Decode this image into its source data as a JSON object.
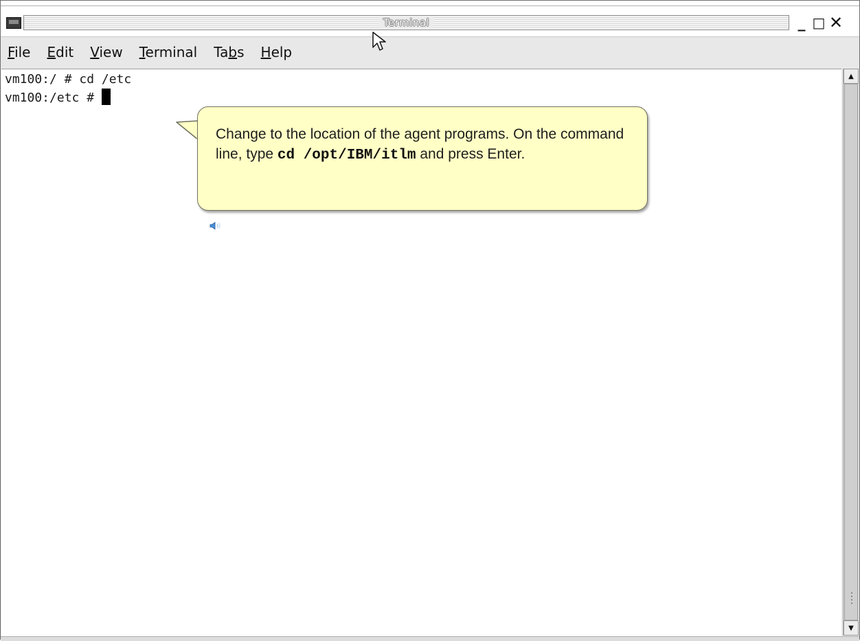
{
  "window": {
    "title": "Terminal",
    "controls": {
      "minimize": "_",
      "maximize": "□",
      "close": "✕"
    }
  },
  "menu": {
    "file": {
      "mnemonic": "F",
      "rest": "ile"
    },
    "edit": {
      "mnemonic": "E",
      "rest": "dit"
    },
    "view": {
      "mnemonic": "V",
      "rest": "iew"
    },
    "terminal": {
      "mnemonic": "T",
      "rest": "erminal"
    },
    "tabs": {
      "pre": "Ta",
      "mnemonic": "b",
      "rest": "s"
    },
    "help": {
      "mnemonic": "H",
      "rest": "elp"
    }
  },
  "terminal": {
    "line1": "vm100:/ # cd /etc",
    "line2_prompt": "vm100:/etc # "
  },
  "callout": {
    "text_before": "Change to the location of the agent programs. On the command line, type ",
    "command": "cd /opt/IBM/itlm",
    "text_after": " and press Enter."
  },
  "icons": {
    "window_icon": "terminal-window-icon",
    "speaker": "speaker-icon",
    "pointer": "mouse-pointer-icon",
    "scroll_up": "▲",
    "scroll_down": "▼"
  },
  "colors": {
    "callout_bg": "#ffffc6",
    "terminal_bg": "#ffffff",
    "chrome_bg": "#e8e8e8"
  }
}
